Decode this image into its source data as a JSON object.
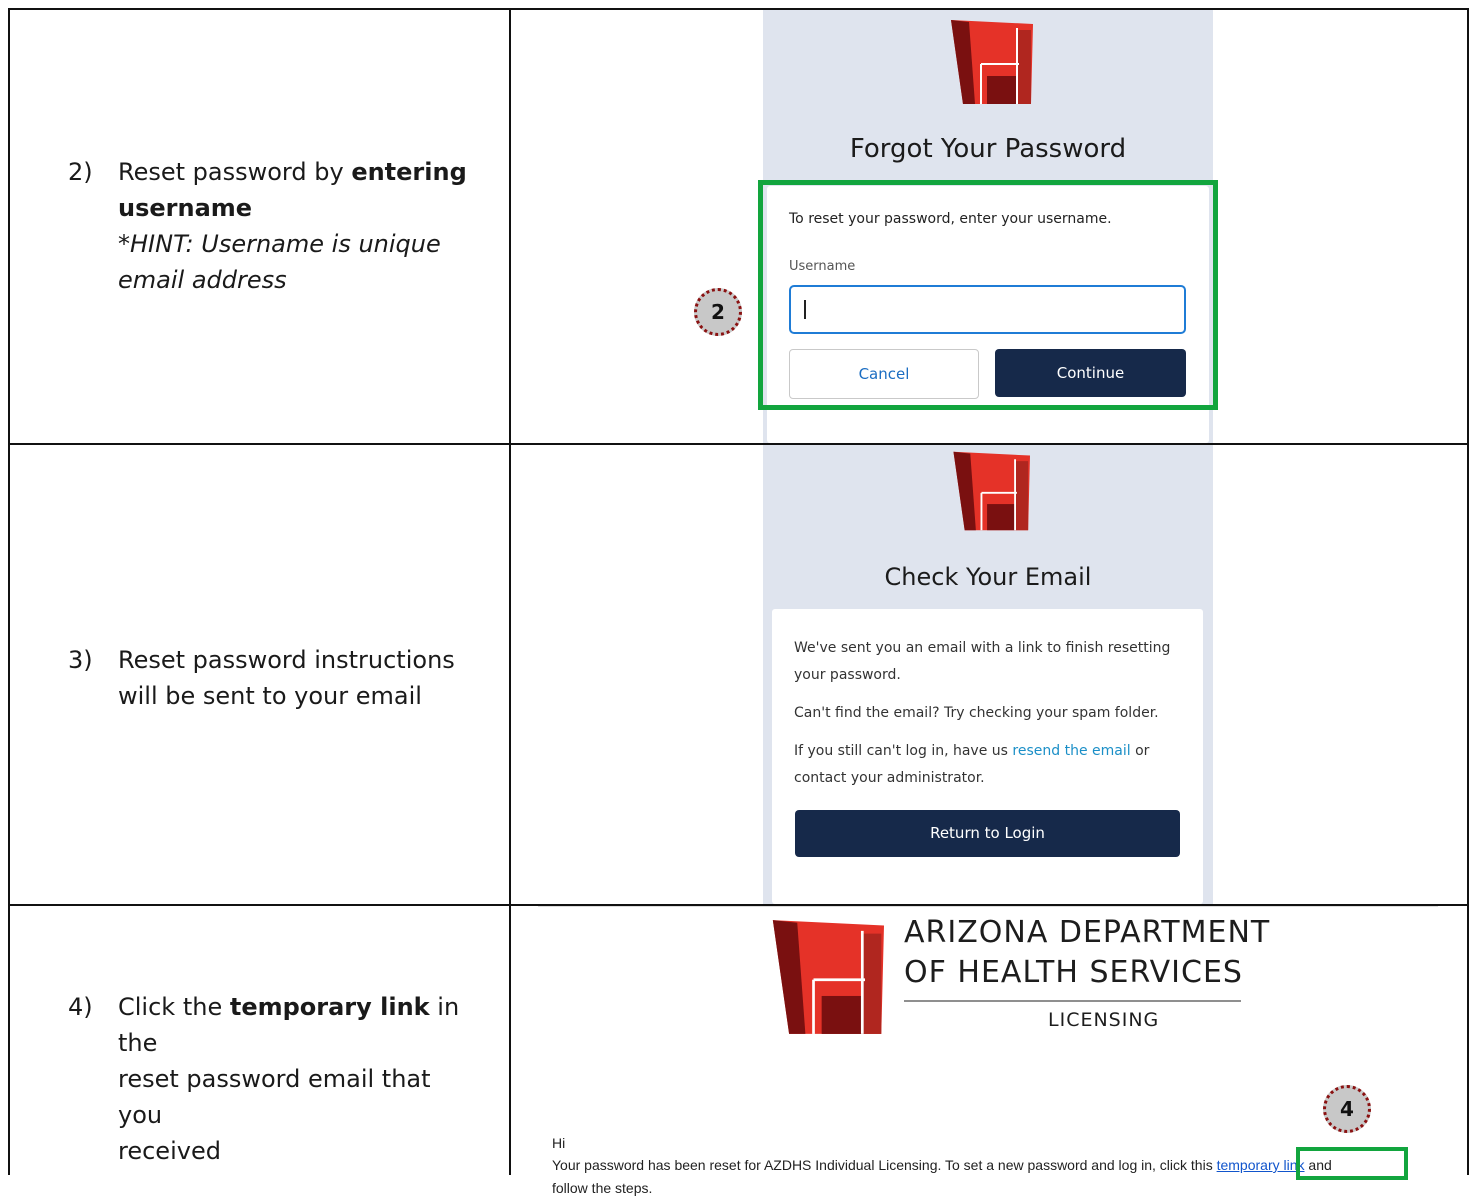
{
  "row1": {
    "step_num": "2)",
    "step_line1_a": "Reset password by ",
    "step_line1_b": "entering",
    "step_line2": "username",
    "hint_line1": "*HINT: Username is unique",
    "hint_line2": "email address",
    "heading": "Forgot Your Password",
    "instruction": "To reset your password, enter your username.",
    "username_label": "Username",
    "username_value": "",
    "cancel_label": "Cancel",
    "continue_label": "Continue",
    "badge": "2"
  },
  "row2": {
    "step_num": "3)",
    "step_line1": "Reset password instructions",
    "step_line2": "will be sent to your email",
    "heading": "Check Your Email",
    "msg1_line1": "We've sent you an email with a link to finish resetting",
    "msg1_line2": "your password.",
    "msg2": "Can't find the email? Try checking your spam folder.",
    "msg3_a": "If you still can't log in, have us ",
    "msg3_link": "resend the email",
    "msg3_b": " or",
    "msg3_line2": "contact your administrator.",
    "return_label": "Return to Login"
  },
  "row3": {
    "step_num": "4)",
    "step_line1_a": "Click the ",
    "step_line1_b": "temporary link",
    "step_line1_c": " in the",
    "step_line2": "reset password email that you",
    "step_line3": "received",
    "org_line1": "ARIZONA DEPARTMENT",
    "org_line2": "OF HEALTH SERVICES",
    "org_line3": "LICENSING",
    "greeting": "Hi",
    "body_a": "Your password has been reset for AZDHS Individual Licensing. To set a new password and log in, click this ",
    "body_link": "temporary link",
    "body_b": " and",
    "body_line2": "follow the steps.",
    "badge": "4"
  },
  "colors": {
    "logo_red": "#e53228",
    "logo_dark_red": "#7a1010",
    "logo_mid_red": "#b0261f",
    "highlight_green": "#12a53e",
    "button_navy": "#16294a",
    "panel_bg": "#dfe4ee"
  }
}
